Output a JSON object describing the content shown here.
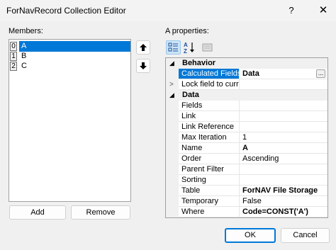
{
  "window": {
    "title": "ForNavRecord Collection Editor",
    "help_label": "?",
    "close_label": "✕"
  },
  "members": {
    "label": "Members:",
    "items": [
      {
        "index": "0",
        "name": "A",
        "selected": true
      },
      {
        "index": "1",
        "name": "B",
        "selected": false
      },
      {
        "index": "2",
        "name": "C",
        "selected": false
      }
    ],
    "add_label": "Add",
    "remove_label": "Remove"
  },
  "properties": {
    "label": "A properties:",
    "categories": [
      {
        "name": "Behavior",
        "expanded": true,
        "rows": [
          {
            "name": "Calculated Fields",
            "value": "Data",
            "bold": true,
            "selected": true,
            "has_ellipsis": true
          },
          {
            "name": "Lock field to curren",
            "value": "",
            "bold": false,
            "expandable": true
          }
        ]
      },
      {
        "name": "Data",
        "expanded": true,
        "rows": [
          {
            "name": "Fields",
            "value": ""
          },
          {
            "name": "Link",
            "value": ""
          },
          {
            "name": "Link Reference",
            "value": ""
          },
          {
            "name": "Max Iteration",
            "value": "1"
          },
          {
            "name": "Name",
            "value": "A",
            "bold": true
          },
          {
            "name": "Order",
            "value": "Ascending"
          },
          {
            "name": "Parent Filter",
            "value": ""
          },
          {
            "name": "Sorting",
            "value": ""
          },
          {
            "name": "Table",
            "value": "ForNAV File Storage",
            "bold": true
          },
          {
            "name": "Temporary",
            "value": "False"
          },
          {
            "name": "Where",
            "value": "Code=CONST('A')",
            "bold": true
          }
        ]
      }
    ]
  },
  "footer": {
    "ok_label": "OK",
    "cancel_label": "Cancel"
  },
  "colors": {
    "accent": "#0078d7",
    "selection_text": "#ffffff"
  }
}
